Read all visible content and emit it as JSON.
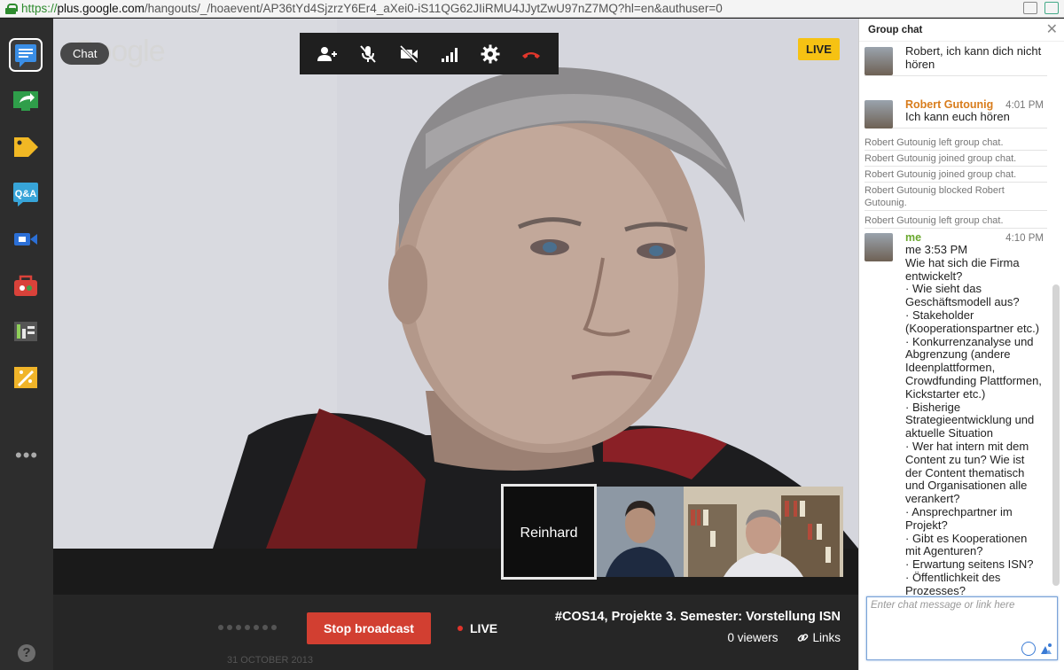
{
  "browser": {
    "url_scheme": "https://",
    "url_host": "plus.google.com",
    "url_rest": "/hangouts/_/hoaevent/AP36tYd4SjzrzY6Er4_aXei0-iS11QG62JIiRMU4JJytZwU97nZ7MQ?hl=en&authuser=0"
  },
  "rail": {
    "apps": [
      "chat",
      "screenshare",
      "tag",
      "qa",
      "camera",
      "toolbox",
      "control-room",
      "effects"
    ],
    "more_label": "•••",
    "help_label": "?"
  },
  "video": {
    "logo": "Google",
    "chat_tooltip": "Chat",
    "live_badge": "LIVE",
    "toolbar": [
      "invite-people",
      "mute-mic",
      "turn-off-camera",
      "bandwidth",
      "settings",
      "hang-up"
    ]
  },
  "thumbnails": {
    "selected_name": "Reinhard",
    "items": [
      "Reinhard",
      "participant-2",
      "participant-3"
    ]
  },
  "broadcast": {
    "stop_label": "Stop broadcast",
    "live_label": "LIVE",
    "title": "#COS14, Projekte 3. Semester: Vorstellung ISN",
    "viewers": "0 viewers",
    "links_label": "Links",
    "footer_peek": "31 OCTOBER 2013"
  },
  "chat": {
    "title": "Group chat",
    "close": "✕",
    "input_placeholder": "Enter chat message or link here",
    "messages": [
      {
        "kind": "msg",
        "name": "",
        "time": "",
        "text": "Robert, ich kann dich nicht hören"
      },
      {
        "kind": "msg",
        "name": "Robert Gutounig",
        "time": "4:01 PM",
        "text": "Ich kann euch hören"
      },
      {
        "kind": "sys",
        "text": "Robert Gutounig left group chat."
      },
      {
        "kind": "sys",
        "text": "Robert Gutounig joined group chat."
      },
      {
        "kind": "sys",
        "text": "Robert Gutounig joined group chat."
      },
      {
        "kind": "sys",
        "text": "Robert Gutounig blocked Robert Gutounig."
      },
      {
        "kind": "sys",
        "text": "Robert Gutounig left group chat."
      },
      {
        "kind": "me",
        "name": "me",
        "time": "4:10 PM",
        "text": "me 3:53 PM\nWie hat sich die Firma entwickelt?\n · Wie sieht das Geschäftsmodell aus?\n · Stakeholder (Kooperationspartner etc.)\n · Konkurrenzanalyse und Abgrenzung (andere Ideenplattformen, Crowdfunding Plattformen, Kickstarter etc.)\n · Bisherige Strategieentwicklung und aktuelle Situation\n · Wer hat intern mit dem Content zu tun? Wie ist der Content thematisch und Organisationen alle verankert?\n · Ansprechpartner im Projekt?\n · Gibt es Kooperationen mit Agenturen?\n · Erwartung seitens ISN?\n · Öffentlichkeit des Prozesses?\nRobert, fragst du weiter?"
      }
    ]
  },
  "colors": {
    "live_yellow": "#f6c213",
    "stop_red": "#d23f31",
    "sender_orange": "#d87c1b",
    "me_green": "#6aa82e"
  }
}
